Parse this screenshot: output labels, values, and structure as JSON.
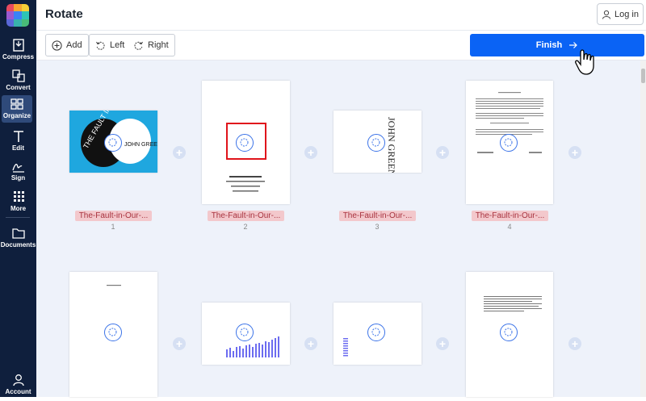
{
  "sidebar": {
    "items": [
      {
        "label": "Compress",
        "icon": "compress-icon"
      },
      {
        "label": "Convert",
        "icon": "convert-icon"
      },
      {
        "label": "Organize",
        "icon": "organize-icon",
        "active": true
      },
      {
        "label": "Edit",
        "icon": "edit-text-icon"
      },
      {
        "label": "Sign",
        "icon": "signature-icon"
      },
      {
        "label": "More",
        "icon": "grid-icon"
      },
      {
        "label": "Documents",
        "icon": "folder-icon"
      }
    ],
    "account_label": "Account"
  },
  "header": {
    "title": "Rotate",
    "login_label": "Log in"
  },
  "toolbar": {
    "add_label": "Add",
    "left_label": "Left",
    "right_label": "Right",
    "finish_label": "Finish"
  },
  "pages": [
    {
      "name": "The-Fault-in-Our-...",
      "number": "1"
    },
    {
      "name": "The-Fault-in-Our-...",
      "number": "2"
    },
    {
      "name": "The-Fault-in-Our-...",
      "number": "3"
    },
    {
      "name": "The-Fault-in-Our-...",
      "number": "4"
    }
  ],
  "thumbnails": {
    "cover_title_text": "THE FAULT IN OUR STARS",
    "cover_author_text": "JOHN GREEN"
  },
  "colors": {
    "sidebar_bg": "#0f1f3d",
    "accent_blue": "#0a63f5",
    "canvas_bg": "#eef2fa",
    "filename_badge": "#f3c8cc",
    "highlight_red": "#e0141b"
  }
}
